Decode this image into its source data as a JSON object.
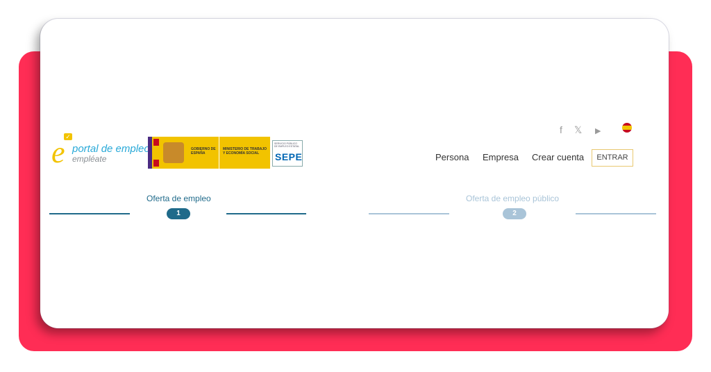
{
  "logos": {
    "empleate_line1": "portal de empleo",
    "empleate_line2": "empléate",
    "gobierno_text": "GOBIERNO DE ESPAÑA",
    "ministerio_text": "MINISTERIO DE TRABAJO Y ECONOMÍA SOCIAL",
    "sepe_small": "SERVICIO PÚBLICO DE EMPLEO ESTATAL",
    "sepe_big": "SEPE"
  },
  "social": {
    "facebook": "f",
    "x": "𝕏",
    "youtube": "▶"
  },
  "nav": {
    "persona": "Persona",
    "empresa": "Empresa",
    "crear_cuenta": "Crear cuenta",
    "entrar": "ENTRAR"
  },
  "steps": [
    {
      "label": "Oferta de empleo",
      "number": "1",
      "color": "#1f6a8a"
    },
    {
      "label": "Oferta de empleo público",
      "number": "2",
      "color": "#a9c4d8"
    }
  ],
  "colors": {
    "background_panel": "#ff2d55",
    "brand_yellow": "#f2c300",
    "link_blue": "#29a9d8"
  }
}
